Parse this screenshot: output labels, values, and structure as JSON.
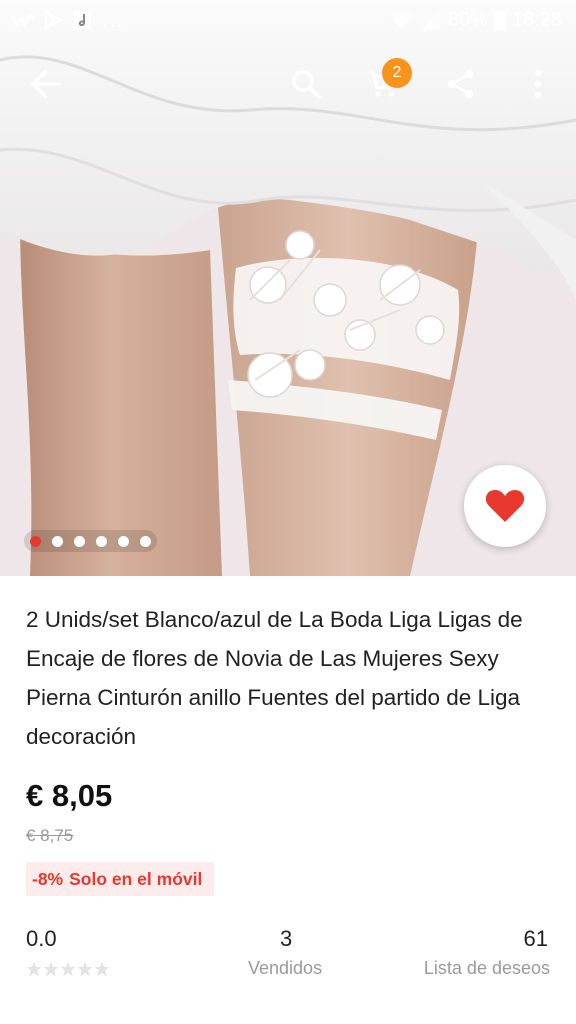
{
  "status_bar": {
    "icons_left": [
      "wish-app-icon",
      "play-store-icon",
      "music-app-icon"
    ],
    "overflow": "...",
    "battery": "80%",
    "time": "18:28"
  },
  "toolbar": {
    "cart_count": "2",
    "icons": [
      "back-arrow-icon",
      "search-icon",
      "cart-icon",
      "share-icon",
      "more-vert-icon"
    ]
  },
  "gallery": {
    "image_count": 6,
    "active_index": 0,
    "colors": {
      "active_dot": "#e8392f",
      "dot": "#ffffff",
      "favorite_heart": "#e8392f"
    }
  },
  "product": {
    "title": "2 Unids/set Blanco/azul de La Boda Liga Ligas de Encaje de flores de Novia de Las Mujeres Sexy Pierna Cinturón anillo Fuentes del partido de Liga decoración",
    "price": "€ 8,05",
    "original_price": "€ 8,75",
    "discount": "-8%",
    "discount_note": "Solo en el móvil"
  },
  "stats": {
    "rating": "0.0",
    "stars_filled": 0,
    "stars_total": 5,
    "sold_count": "3",
    "sold_label": "Vendidos",
    "wishlist_count": "61",
    "wishlist_label": "Lista de deseos"
  },
  "colors": {
    "accent": "#e8392f",
    "badge": "#f7941d",
    "promo_background": "#fdecec",
    "muted_text": "#9a9a9a"
  }
}
